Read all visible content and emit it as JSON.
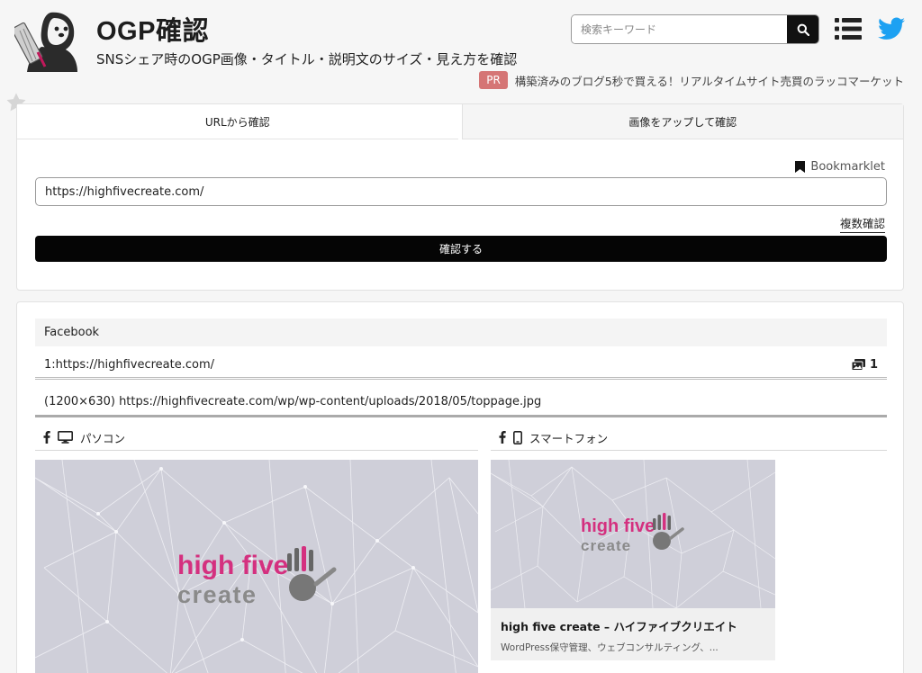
{
  "header": {
    "title": "OGP確認",
    "subtitle": "SNSシェア時のOGP画像・タイトル・説明文のサイズ・見え方を確認",
    "search_placeholder": "検索キーワード",
    "pr_badge": "PR",
    "pr_text": "構築済みのブログ5秒で買える！リアルタイムサイト売買のラッコマーケット"
  },
  "tabs": [
    {
      "label": "URLから確認",
      "active": true
    },
    {
      "label": "画像をアップして確認",
      "active": false
    }
  ],
  "form": {
    "bookmarklet_label": "Bookmarklet",
    "url_value": "https://highfivecreate.com/",
    "multi_label": "複数確認",
    "confirm_label": "確認する"
  },
  "result": {
    "platform": "Facebook",
    "url_line": "1:https://highfivecreate.com/",
    "image_count": "1",
    "image_info": "(1200×630) https://highfivecreate.com/wp/wp-content/uploads/2018/05/toppage.jpg",
    "pc_label": "パソコン",
    "sp_label": "スマートフォン",
    "logo_line1": "high five",
    "logo_line2": "create",
    "sp_title": "high five create – ハイファイブクリエイト",
    "sp_desc": "WordPress保守管理、ウェブコンサルティング、..."
  },
  "colors": {
    "accent_pink": "#d4307f",
    "pr_badge": "#d57575",
    "twitter_blue": "#1da1f2",
    "button_black": "#050505"
  }
}
